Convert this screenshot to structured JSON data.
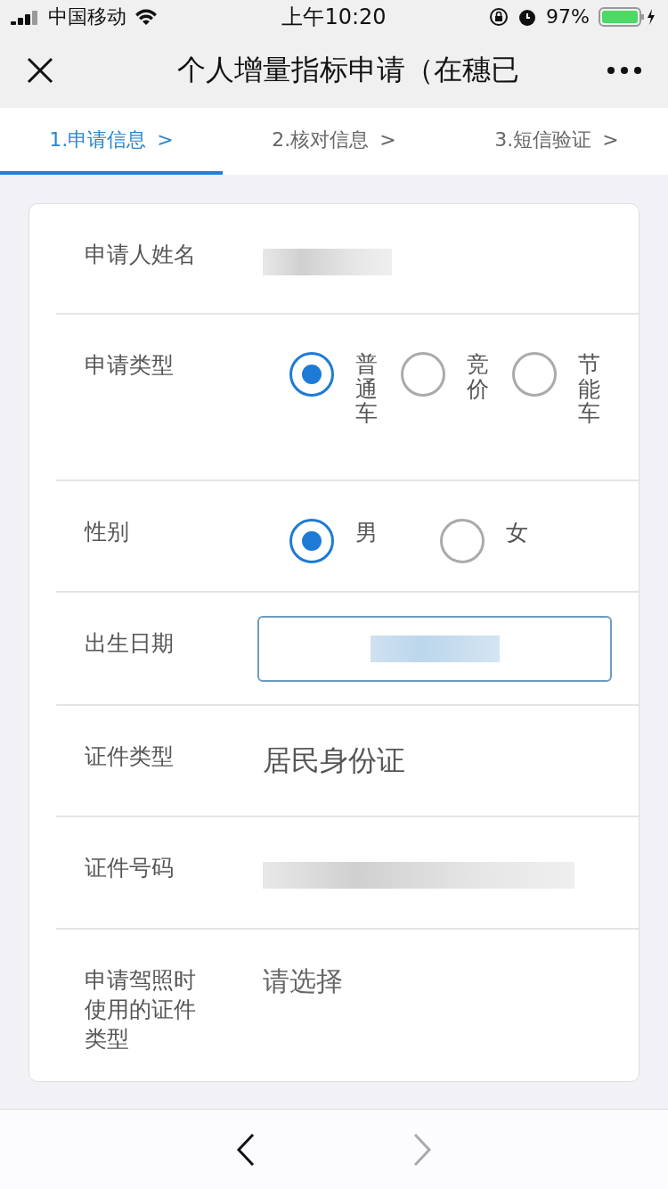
{
  "status_bar": {
    "carrier": "中国移动",
    "time": "上午10:20",
    "battery": "97%"
  },
  "nav": {
    "title": "个人增量指标申请（在穗已"
  },
  "steps": [
    {
      "label": "1.申请信息",
      "arrow": ">",
      "selected": true
    },
    {
      "label": "2.核对信息",
      "arrow": ">",
      "selected": false
    },
    {
      "label": "3.短信验证",
      "arrow": ">",
      "selected": false
    }
  ],
  "form": {
    "rows": [
      {
        "kind": "redacted",
        "label": "申请人姓名"
      },
      {
        "kind": "radio",
        "label": "申请类型",
        "vertical": true,
        "options": [
          {
            "label": "普通车",
            "selected": true
          },
          {
            "label": "竞价",
            "selected": false
          },
          {
            "label": "节能车",
            "selected": false
          }
        ]
      },
      {
        "kind": "radio",
        "label": "性别",
        "vertical": false,
        "options": [
          {
            "label": "男",
            "selected": true
          },
          {
            "label": "女",
            "selected": false
          }
        ]
      },
      {
        "kind": "input",
        "label": "出生日期"
      },
      {
        "kind": "text",
        "label": "证件类型",
        "value": "居民身份证"
      },
      {
        "kind": "redacted",
        "label": "证件号码"
      },
      {
        "kind": "select",
        "label": "申请驾照时使用的证件类型",
        "placeholder": "请选择"
      }
    ]
  },
  "toolbar": {
    "back": {
      "disabled": false
    },
    "forward": {
      "disabled": true
    }
  }
}
